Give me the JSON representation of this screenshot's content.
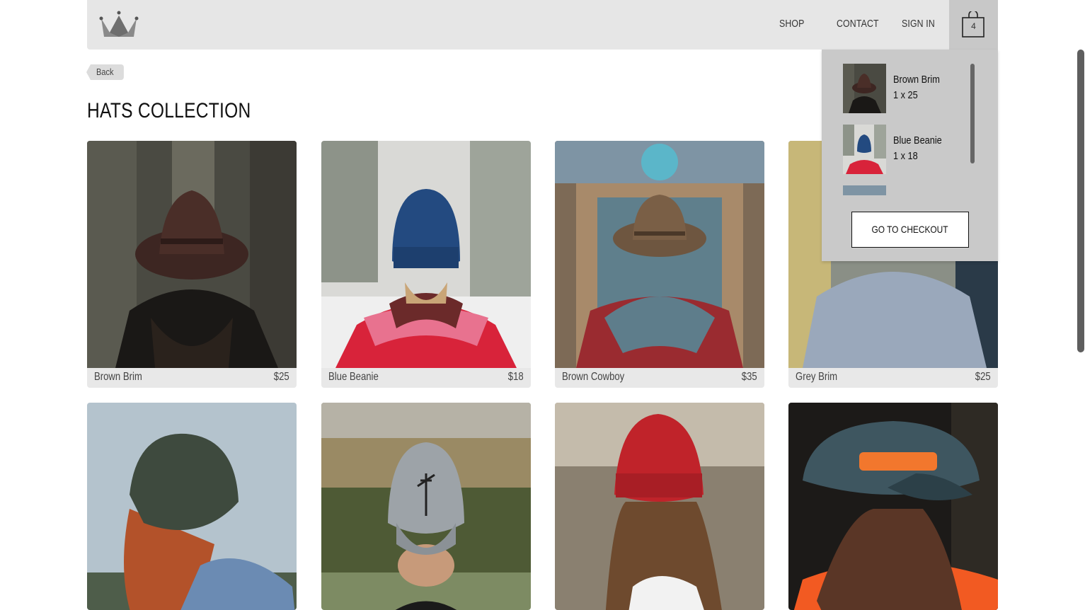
{
  "header": {
    "logo_alt": "crown-logo",
    "nav": [
      {
        "label": "SHOP"
      },
      {
        "label": "CONTACT"
      },
      {
        "label": "SIGN IN"
      }
    ],
    "cart_count": "4"
  },
  "back": {
    "label": "Back"
  },
  "page": {
    "title": "HATS COLLECTION"
  },
  "products": [
    {
      "name": "Brown Brim",
      "price": "$25"
    },
    {
      "name": "Blue Beanie",
      "price": "$18"
    },
    {
      "name": "Brown Cowboy",
      "price": "$35"
    },
    {
      "name": "Grey Brim",
      "price": "$25"
    },
    {
      "name": "",
      "price": ""
    },
    {
      "name": "",
      "price": ""
    },
    {
      "name": "",
      "price": ""
    },
    {
      "name": "",
      "price": ""
    }
  ],
  "cart": {
    "items": [
      {
        "name": "Brown Brim",
        "qty": "1 x 25"
      },
      {
        "name": "Blue Beanie",
        "qty": "1 x 18"
      }
    ],
    "checkout_label": "GO TO CHECKOUT"
  },
  "colors": {
    "header_bg": "#e6e6e6",
    "cart_tab_bg": "#c8c8c8",
    "dropdown_bg": "#c9c9c9",
    "card_footer_bg": "#e8e8e8"
  }
}
